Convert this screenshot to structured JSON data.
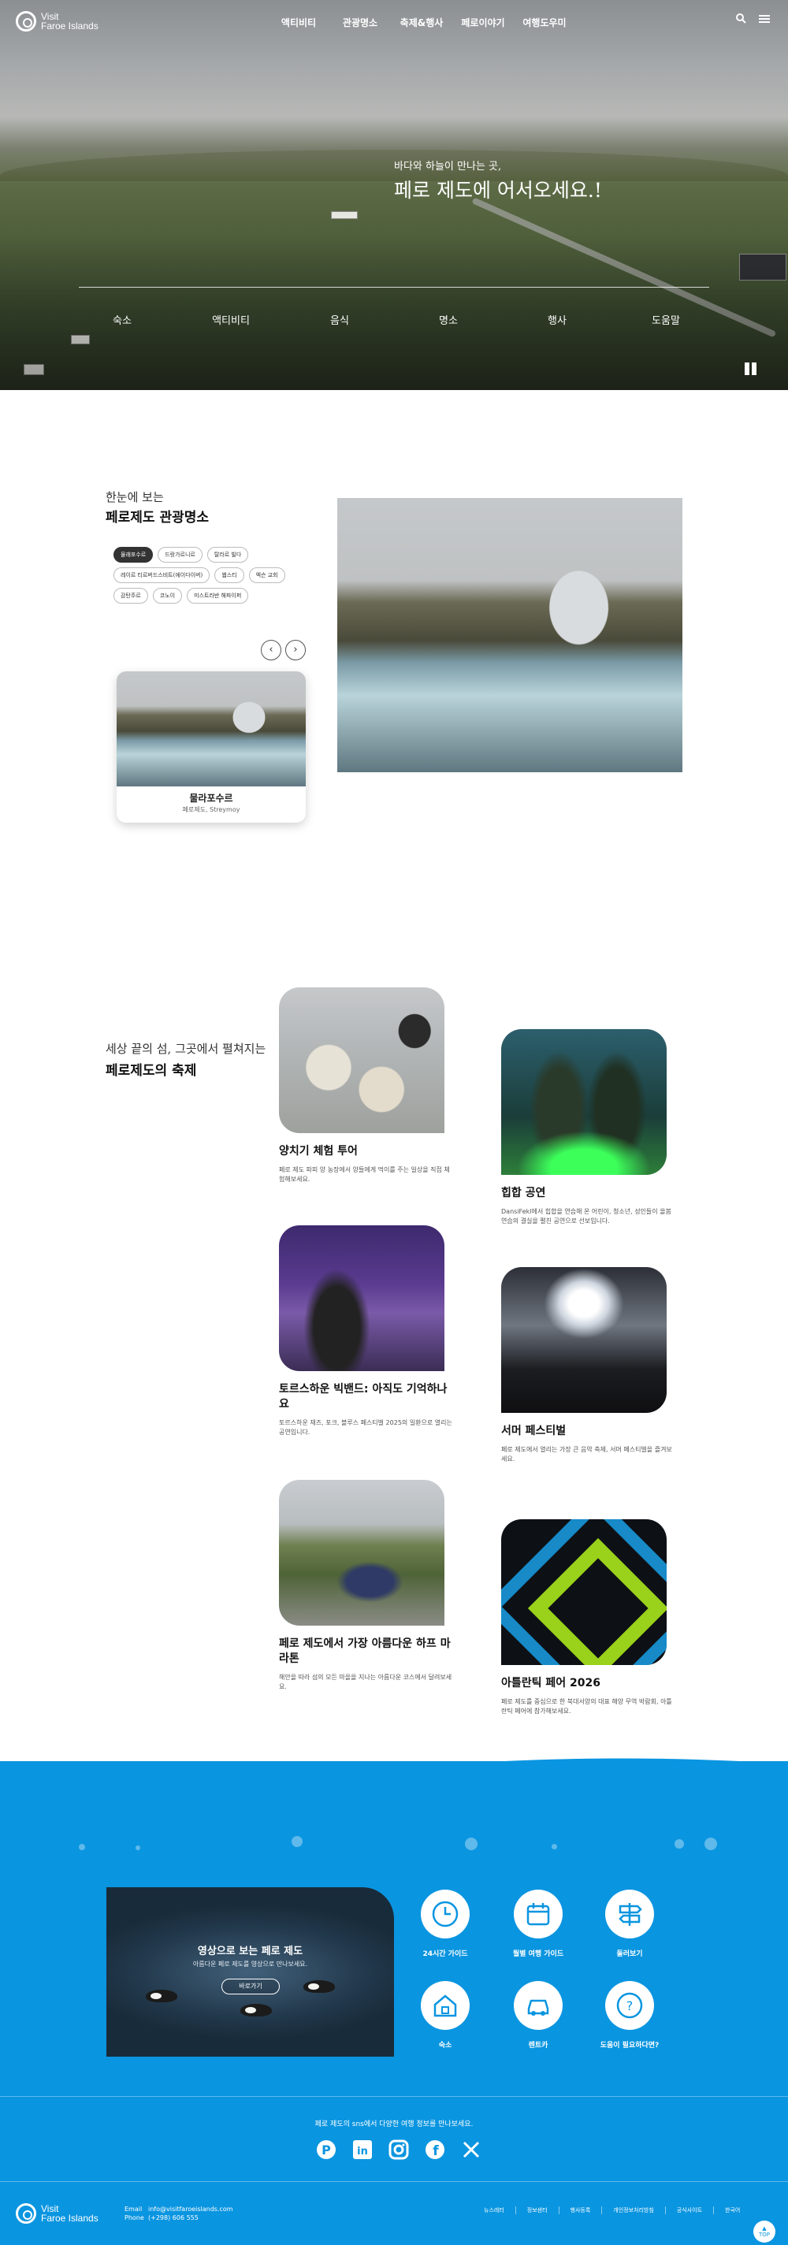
{
  "nav": {
    "logo_line1": "Visit",
    "logo_line2": "Faroe Islands",
    "menu": [
      "액티비티",
      "관광명소",
      "축제&행사",
      "페로이야기",
      "여행도우미"
    ]
  },
  "hero": {
    "subtitle": "바다와 하늘이 만나는 곳,",
    "title": "페로 제도에 어서오세요.!",
    "tabs": [
      "숙소",
      "액티비티",
      "음식",
      "명소",
      "행사",
      "도움말"
    ]
  },
  "attractions": {
    "subtitle": "한눈에 보는",
    "title": "페로제도 관광명소",
    "chips": [
      "물래포수르",
      "드랑가르니르",
      "탈라르 빌다",
      "레이르 티르버드스비트(에이다이버)",
      "웹스티",
      "엑슨 교회",
      "감탄주르",
      "코노이",
      "미스트라반 해파이퍼"
    ],
    "active_chip": 0,
    "card_title": "물라포수르",
    "card_location": "페로제도, Streymoy"
  },
  "festivals": {
    "subtitle": "세상 끝의 섬, 그곳에서 펼쳐지는",
    "title": "페로제도의 축제",
    "items": [
      {
        "title": "양치기 체험 투어",
        "desc": "페로 제도 파피 양 농장에서 양들에게 먹이를 주는 일상을 직접 체험해보세요."
      },
      {
        "title": "힙합 공연",
        "desc": "DansiFekl에서 힙합을 연습해 온 어린이, 청소년, 성인들이 올봄 연습의 결실을 펼친 공연으로 선보입니다."
      },
      {
        "title": "토르스하운 빅밴드: 아직도 기억하나요",
        "desc": "토르스하운 재즈, 포크, 블루스 페스티벌 2025의 일환으로 열리는 공연입니다."
      },
      {
        "title": "서머 페스티벌",
        "desc": "페로 제도에서 열리는 가장 큰 음악 축제, 서머 페스티벌을 즐겨보세요."
      },
      {
        "title": "페로 제도에서 가장 아름다운 하프 마라톤",
        "desc": "해안을 따라 섬의 모든 마을을 지나는 아름다운 코스에서 달려보세요."
      },
      {
        "title": "아틀란틱 페어 2026",
        "desc": "페로 제도를 중심으로 한 북대서양의 대표 해양 무역 박람회, 아틀란틱 페어에 참가해보세요."
      }
    ]
  },
  "video": {
    "title": "영상으로 보는 페로 제도",
    "desc": "아름다운 페로 제도를 영상으로 만나보세요.",
    "button": "바로가기"
  },
  "services": [
    "24시간 가이드",
    "월별 여행 가이드",
    "둘러보기",
    "숙소",
    "렌트카",
    "도움이 필요하다면?"
  ],
  "footer": {
    "message": "페로 제도의 sns에서 다양한 여행 정보를 만나보세요.",
    "social": [
      "pinterest-icon",
      "linkedin-icon",
      "instagram-icon",
      "facebook-icon",
      "x-icon"
    ],
    "email_label": "Email",
    "email": "info@visitfaroeislands.com",
    "phone_label": "Phone",
    "phone": "(+298) 606 555",
    "links": [
      "뉴스레터",
      "정보센터",
      "행사등록",
      "개인정보처리방침",
      "공식사이트",
      "한국어"
    ],
    "top_label": "TOP"
  },
  "colors": {
    "brand_blue": "#0a95e0"
  }
}
